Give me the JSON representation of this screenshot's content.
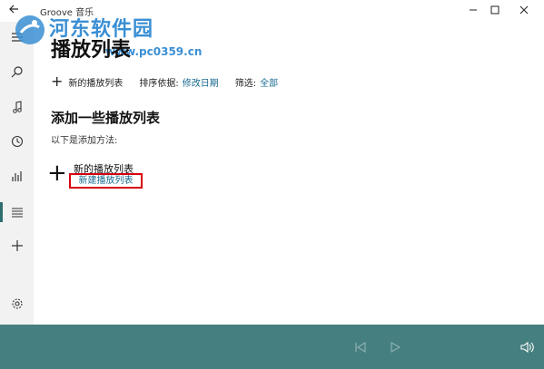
{
  "app": {
    "title": "Groove 音乐"
  },
  "watermark": {
    "text": "河东软件园",
    "url": "www.pc0359.cn"
  },
  "page": {
    "title": "播放列表"
  },
  "toolbar": {
    "new_playlist_label": "新的播放列表",
    "sort_label": "排序依据:",
    "sort_value": "修改日期",
    "filter_label": "筛选:",
    "filter_value": "全部"
  },
  "empty_state": {
    "heading": "添加一些播放列表",
    "subheading": "以下是添加方法:",
    "new_playlist_title": "新的播放列表",
    "new_playlist_link": "新建播放列表"
  },
  "sidebar": {
    "icons": [
      "hamburger-icon",
      "search-icon",
      "music-note-icon",
      "clock-icon",
      "chart-icon",
      "playlist-icon",
      "plus-icon",
      "gear-icon"
    ],
    "active": "playlist-icon"
  },
  "colors": {
    "accent": "#467f7f",
    "link": "#1a6b8f",
    "highlight_box": "#d9000d"
  }
}
